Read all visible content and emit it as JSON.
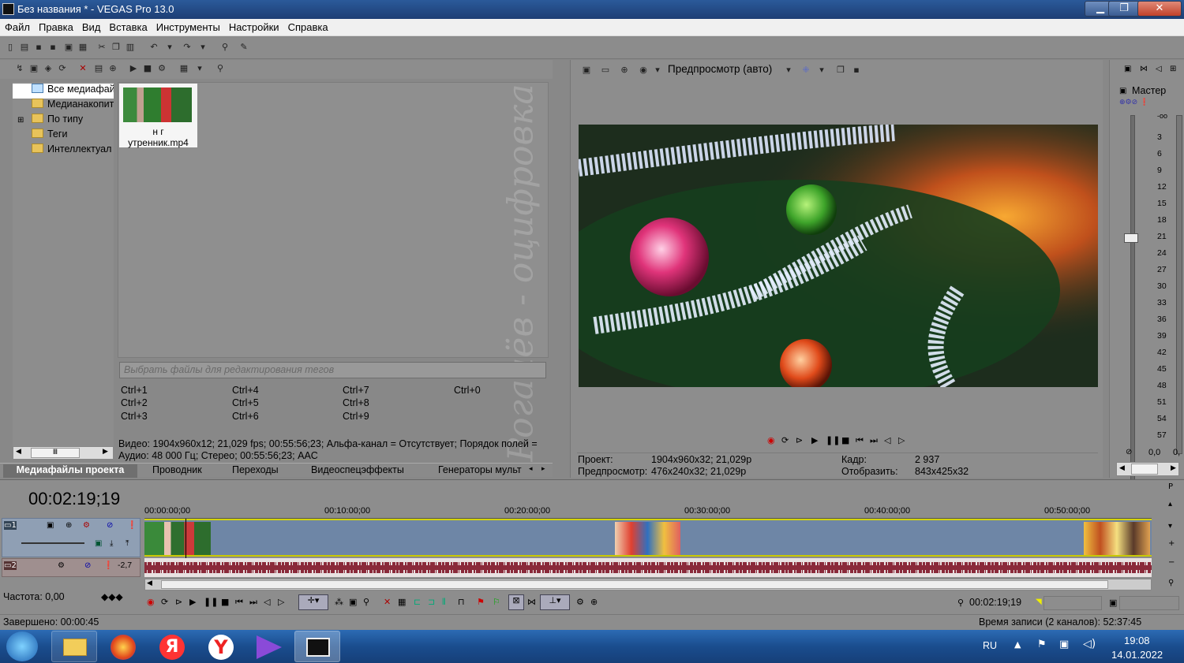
{
  "window": {
    "title": "Без названия * - VEGAS Pro 13.0",
    "minimize": "▁",
    "maximize": "❐",
    "close": "✕"
  },
  "menu": [
    "Файл",
    "Правка",
    "Вид",
    "Вставка",
    "Инструменты",
    "Настройки",
    "Справка"
  ],
  "explorer": {
    "tree": [
      "Все медиафайлы",
      "Медианакопит",
      "По типу",
      "Теги",
      "Интеллектуал"
    ],
    "thumb_label_1": "н г",
    "thumb_label_2": "утренник.mp4",
    "tag_placeholder": "Выбрать файлы для редактирования тегов",
    "shortcuts": [
      [
        "Ctrl+1",
        "Ctrl+4",
        "Ctrl+7",
        "Ctrl+0"
      ],
      [
        "Ctrl+2",
        "Ctrl+5",
        "Ctrl+8",
        ""
      ],
      [
        "Ctrl+3",
        "Ctrl+6",
        "Ctrl+9",
        ""
      ]
    ],
    "info_video": "Видео: 1904x960x12; 21,029 fps; 00:55:56;23; Альфа-канал = Отсутствует; Порядок полей =",
    "info_audio": "Аудио: 48 000 Гц; Стерео; 00:55:56;23; AAC",
    "watermark": "Рогачёв - оцифровка"
  },
  "tabs": [
    "Медиафайлы проекта",
    "Проводник",
    "Переходы",
    "Видеоспецэффекты",
    "Генераторы мульт"
  ],
  "preview": {
    "mode": "Предпросмотр (авто)",
    "project_label": "Проект:",
    "project_value": "1904x960x32; 21,029p",
    "preview_label": "Предпросмотр:",
    "preview_value": "476x240x32; 21,029p",
    "frame_label": "Кадр:",
    "frame_value": "2 937",
    "display_label": "Отобразить:",
    "display_value": "843x425x32"
  },
  "mixer": {
    "title": "Мастер",
    "scale": [
      "-oo",
      "3",
      "6",
      "9",
      "12",
      "15",
      "18",
      "21",
      "24",
      "27",
      "30",
      "33",
      "36",
      "39",
      "42",
      "45",
      "48",
      "51",
      "54",
      "57"
    ],
    "value_left": "0,0",
    "value_right": "0,"
  },
  "timeline": {
    "timecode": "00:02:19;19",
    "ruler": [
      "00:00:00;00",
      "00:10:00;00",
      "00:20:00;00",
      "00:30:00;00",
      "00:40:00;00",
      "00:50:00;00"
    ],
    "audio_level": "-2,7",
    "rate_label": "Частота: 0,00",
    "cursor_time": "00:02:19;19"
  },
  "status": {
    "left": "Завершено: 00:00:45",
    "right": "Время записи (2 каналов): 52:37:45"
  },
  "taskbar": {
    "lang": "RU",
    "time": "19:08",
    "date": "14.01.2022"
  }
}
